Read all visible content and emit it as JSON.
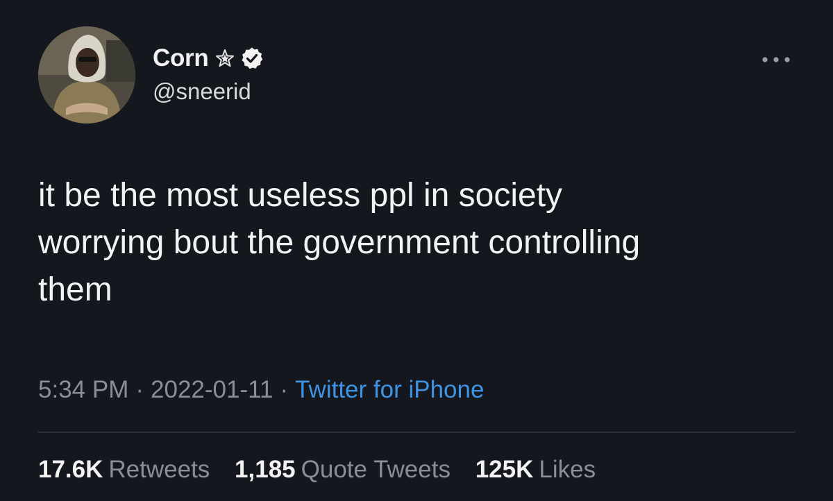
{
  "user": {
    "display_name": "Corn",
    "handle": "@sneerid",
    "badges": [
      "star-icon",
      "verified-icon"
    ]
  },
  "tweet": {
    "text": "it be the most useless ppl in society\nworrying bout the government controlling\nthem"
  },
  "meta": {
    "time": "5:34 PM",
    "separator": "·",
    "date": "2022-01-11",
    "source": "Twitter for iPhone"
  },
  "stats": {
    "retweets_count": "17.6K",
    "retweets_label": "Retweets",
    "quotes_count": "1,185",
    "quotes_label": "Quote Tweets",
    "likes_count": "125K",
    "likes_label": "Likes"
  },
  "icons": {
    "more": "more-options-icon"
  },
  "colors": {
    "background": "#15171e",
    "link": "#3f93e3",
    "muted": "#8b8f95"
  }
}
